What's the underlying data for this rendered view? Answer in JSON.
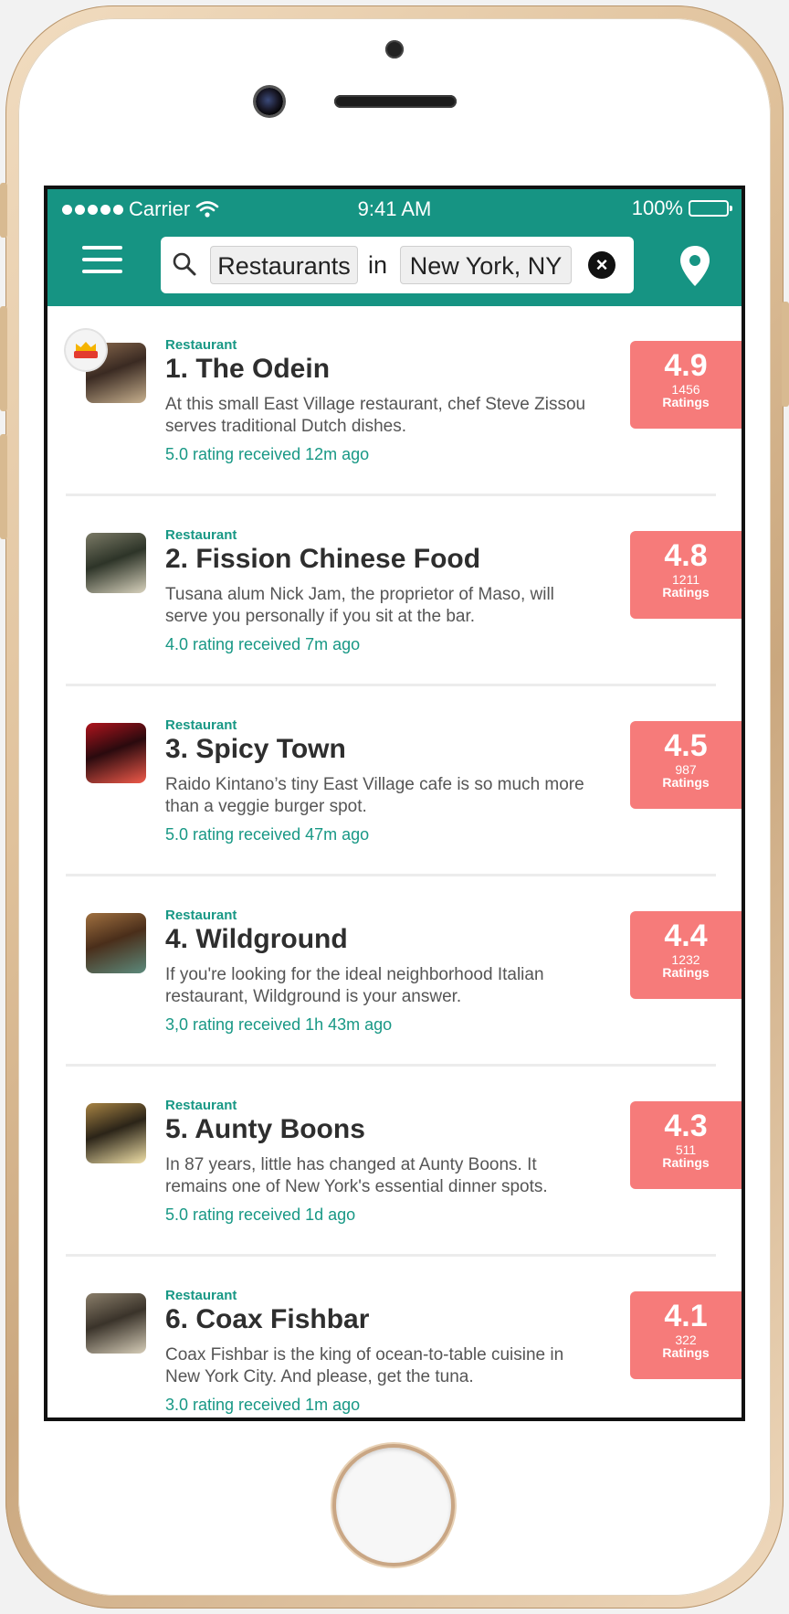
{
  "status_bar": {
    "carrier": "Carrier",
    "time": "9:41 AM",
    "battery": "100%"
  },
  "search": {
    "what": "Restaurants",
    "connector": "in",
    "where": "New York, NY",
    "clear_icon": "close-icon"
  },
  "colors": {
    "brand": "#169483",
    "accent_text": "#189885",
    "score_badge": "#f67b7a"
  },
  "results": [
    {
      "category": "Restaurant",
      "title": "1. The Odein",
      "description": "At this small East Village restaurant, chef Steve Zissou serves traditional Dutch dishes.",
      "recent": "5.0 rating received 12m ago",
      "score": "4.9",
      "count": "1456",
      "count_label": "Ratings",
      "featured": true,
      "thumb_colors": [
        "#3a2a22",
        "#8a6a4e",
        "#c7b08e"
      ]
    },
    {
      "category": "Restaurant",
      "title": "2. Fission Chinese Food",
      "description": "Tusana alum Nick Jam, the proprietor of Maso, will serve you personally if you sit at the bar.",
      "recent": "4.0 rating received 7m ago",
      "score": "4.8",
      "count": "1211",
      "count_label": "Ratings",
      "featured": false,
      "thumb_colors": [
        "#2d3428",
        "#7b7a66",
        "#d8d2bd"
      ]
    },
    {
      "category": "Restaurant",
      "title": "3. Spicy Town",
      "description": "Raido Kintano’s tiny East Village cafe is so much more than a veggie burger spot.",
      "recent": "5.0 rating received 47m ago",
      "score": "4.5",
      "count": "987",
      "count_label": "Ratings",
      "featured": false,
      "thumb_colors": [
        "#2a0a0e",
        "#b0141d",
        "#f05a4a"
      ]
    },
    {
      "category": "Restaurant",
      "title": "4. Wildground",
      "description": "If you're looking for the ideal neighborhood Italian restaurant, Wildground is your answer.",
      "recent": "3,0 rating received 1h 43m ago",
      "score": "4.4",
      "count": "1232",
      "count_label": "Ratings",
      "featured": false,
      "thumb_colors": [
        "#4a2e1a",
        "#a07040",
        "#5c8a7c"
      ]
    },
    {
      "category": "Restaurant",
      "title": "5. Aunty Boons",
      "description": "In 87 years, little has changed at Aunty Boons. It remains one of New York's essential dinner spots.",
      "recent": "5.0 rating received 1d ago",
      "score": "4.3",
      "count": "511",
      "count_label": "Ratings",
      "featured": false,
      "thumb_colors": [
        "#2b2418",
        "#a88444",
        "#f0e0a8"
      ]
    },
    {
      "category": "Restaurant",
      "title": "6. Coax Fishbar",
      "description": "Coax Fishbar is the king of ocean-to-table cuisine in New York City. And please, get the tuna.",
      "recent": "3.0 rating received 1m ago",
      "score": "4.1",
      "count": "322",
      "count_label": "Ratings",
      "featured": false,
      "thumb_colors": [
        "#3a332a",
        "#8a7e6a",
        "#d6cdb8"
      ]
    }
  ]
}
